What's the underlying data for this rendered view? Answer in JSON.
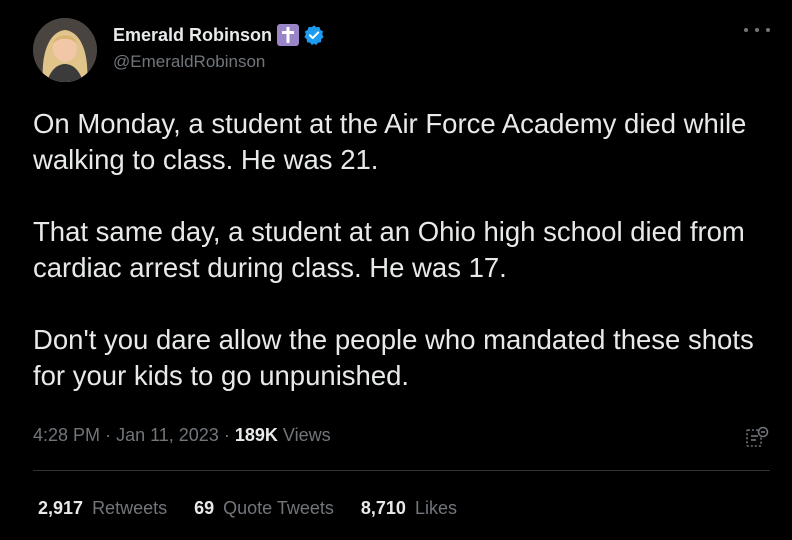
{
  "author": {
    "display_name": "Emerald Robinson",
    "handle": "@EmeraldRobinson",
    "badge_icons": [
      "cross-icon",
      "verified-icon"
    ]
  },
  "tweet": {
    "paragraphs": [
      "On Monday, a student at the Air Force Academy died while walking to class. He was 21.",
      "That same day, a student at an Ohio high school died from cardiac arrest during class. He was 17.",
      "Don't you dare allow the people who mandated these shots for your kids to go unpunished."
    ],
    "time": "4:28 PM",
    "date": "Jan 11, 2023",
    "views_count": "189K",
    "views_label": "Views"
  },
  "stats": {
    "retweets": {
      "count": "2,917",
      "label": "Retweets"
    },
    "quotes": {
      "count": "69",
      "label": "Quote Tweets"
    },
    "likes": {
      "count": "8,710",
      "label": "Likes"
    }
  },
  "colors": {
    "background": "#000000",
    "text": "#e7e9ea",
    "secondary": "#71767b",
    "verified": "#1d9bf0",
    "cross_badge": "#9a85c8"
  }
}
